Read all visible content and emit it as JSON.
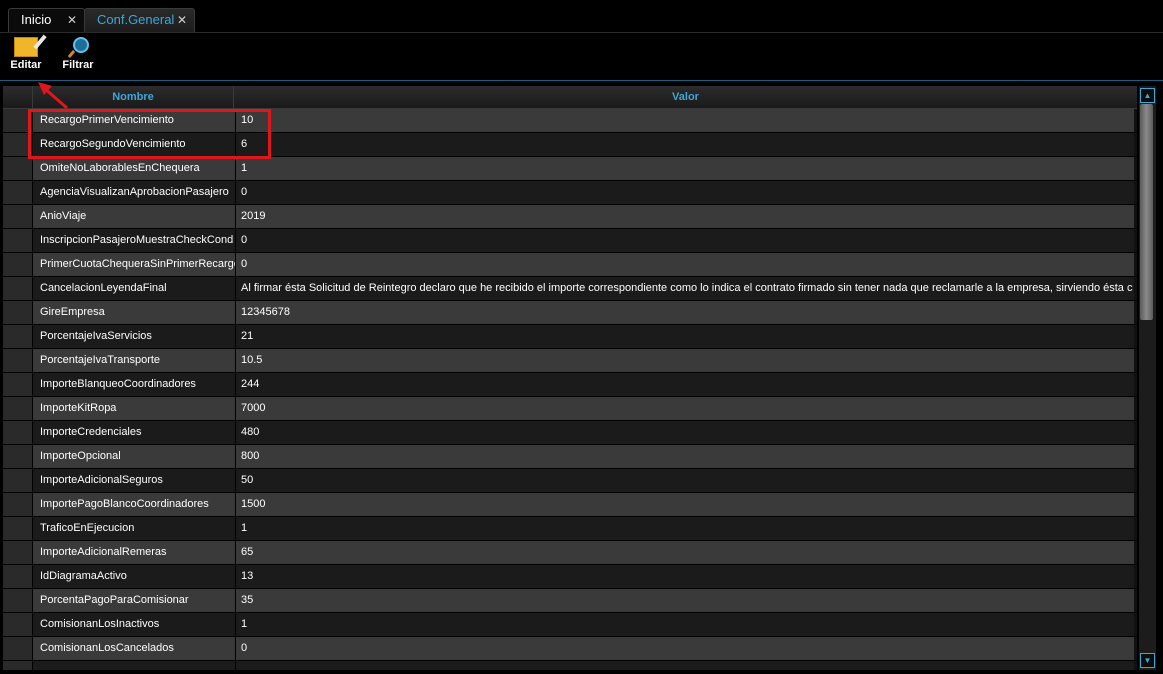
{
  "tabs": [
    {
      "label": "Inicio",
      "close": "✕"
    },
    {
      "label": "Conf.General",
      "close": "✕"
    }
  ],
  "toolbar": {
    "edit_label": "Editar",
    "filter_label": "Filtrar",
    "edit_icon": "edit-icon",
    "filter_icon": "search-icon"
  },
  "grid": {
    "columns": {
      "name": "Nombre",
      "value": "Valor"
    },
    "rows": [
      {
        "name": "RecargoPrimerVencimiento",
        "value": "10"
      },
      {
        "name": "RecargoSegundoVencimiento",
        "value": "6"
      },
      {
        "name": "OmiteNoLaborablesEnChequera",
        "value": "1"
      },
      {
        "name": "AgenciaVisualizanAprobacionPasajero",
        "value": "0"
      },
      {
        "name": "AnioViaje",
        "value": "2019"
      },
      {
        "name": "InscripcionPasajeroMuestraCheckCond",
        "value": "0"
      },
      {
        "name": "PrimerCuotaChequeraSinPrimerRecargo",
        "value": "0"
      },
      {
        "name": "CancelacionLeyendaFinal",
        "value": "Al firmar ésta Solicitud de Reintegro declaro que he recibido el importe correspondiente como lo indica el contrato firmado sin tener nada que reclamarle a la empresa, sirviendo ésta c"
      },
      {
        "name": "GireEmpresa",
        "value": "12345678"
      },
      {
        "name": "PorcentajeIvaServicios",
        "value": "21"
      },
      {
        "name": "PorcentajeIvaTransporte",
        "value": "10.5"
      },
      {
        "name": "ImporteBlanqueoCoordinadores",
        "value": "244"
      },
      {
        "name": "ImporteKitRopa",
        "value": "7000"
      },
      {
        "name": "ImporteCredenciales",
        "value": "480"
      },
      {
        "name": "ImporteOpcional",
        "value": "800"
      },
      {
        "name": "ImporteAdicionalSeguros",
        "value": "50"
      },
      {
        "name": "ImportePagoBlancoCoordinadores",
        "value": "1500"
      },
      {
        "name": "TraficoEnEjecucion",
        "value": "1"
      },
      {
        "name": "ImporteAdicionalRemeras",
        "value": "65"
      },
      {
        "name": "IdDiagramaActivo",
        "value": "13"
      },
      {
        "name": "PorcentaPagoParaComisionar",
        "value": "35"
      },
      {
        "name": "ComisionanLosInactivos",
        "value": "1"
      },
      {
        "name": "ComisionanLosCancelados",
        "value": "0"
      },
      {
        "name": "",
        "value": ""
      }
    ]
  },
  "scrollbar": {
    "up": "▲",
    "down": "▼"
  },
  "colors": {
    "accent": "#3ea7d6",
    "annotation": "#e0161d",
    "background": "#000000"
  }
}
